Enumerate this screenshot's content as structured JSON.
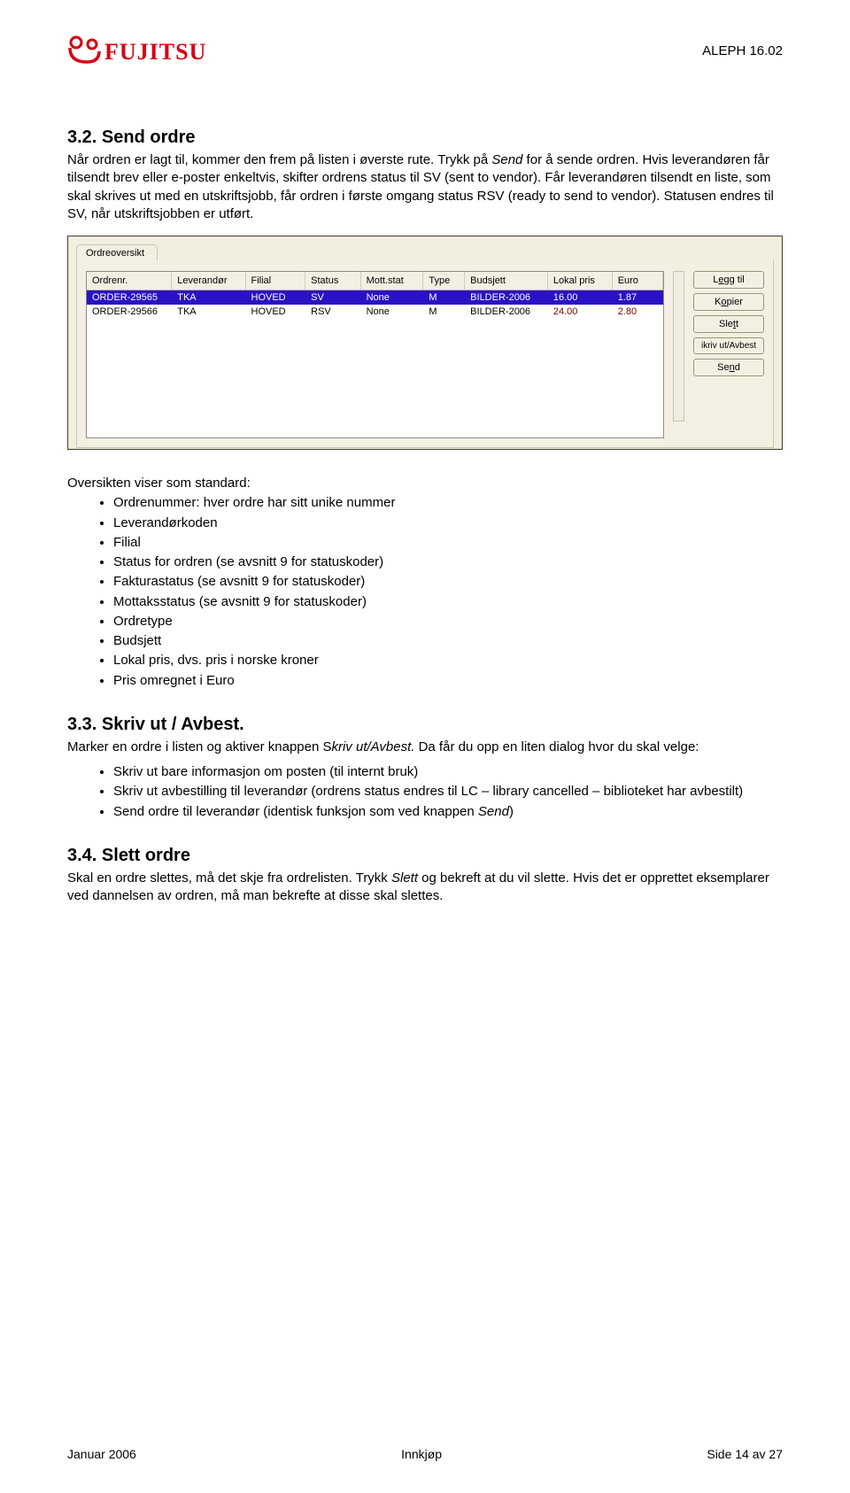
{
  "header": {
    "logo_text": "FUJITSU",
    "right": "ALEPH 16.02"
  },
  "sections": {
    "s32": {
      "title": "3.2.   Send ordre",
      "p1a": "Når ordren er lagt til, kommer den frem på listen i øverste rute. Trykk på ",
      "p1b_i": "Send",
      "p1c": " for å sende ordren. Hvis leverandøren får tilsendt brev eller e-poster enkeltvis, skifter ordrens status til SV (sent to vendor). Får leverandøren tilsendt en liste, som skal skrives ut med en utskriftsjobb, får ordren i første omgang status RSV (ready to send to vendor). Statusen endres til SV, når utskriftsjobben er utført."
    },
    "overview": {
      "intro": "Oversikten viser som standard:",
      "items": [
        "Ordrenummer: hver ordre har sitt unike nummer",
        "Leverandørkoden",
        "Filial",
        "Status for ordren (se avsnitt 9 for statuskoder)",
        "Fakturastatus (se avsnitt 9 for statuskoder)",
        "Mottaksstatus (se avsnitt 9 for statuskoder)",
        "Ordretype",
        "Budsjett",
        "Lokal pris, dvs. pris i norske kroner",
        "Pris omregnet i Euro"
      ]
    },
    "s33": {
      "title": "3.3.   Skriv ut / Avbest.",
      "p1a": "Marker en ordre i listen og aktiver knappen S",
      "p1b_i": "kriv ut/Avbest.",
      "p1c": " Da får du opp en liten dialog hvor du skal velge:",
      "items": [
        "Skriv ut bare informasjon om posten (til internt bruk)",
        "Skriv ut avbestilling til leverandør (ordrens status endres til LC – library cancelled – biblioteket har avbestilt)"
      ],
      "item3a": "Send ordre til leverandør (identisk funksjon som ved knappen ",
      "item3b_i": "Send",
      "item3c": ")"
    },
    "s34": {
      "title": "3.4.   Slett ordre",
      "p1a": "Skal en ordre slettes, må det skje fra ordrelisten. Trykk ",
      "p1b_i": "Slett",
      "p1c": " og bekreft at du vil slette. Hvis det er opprettet eksemplarer ved dannelsen av ordren, må man bekrefte at disse skal slettes."
    }
  },
  "app": {
    "tab": "Ordreoversikt",
    "headers": [
      "Ordrenr.",
      "Leverandør",
      "Filial",
      "Status",
      "Mott.stat",
      "Type",
      "Budsjett",
      "Lokal pris",
      "Euro"
    ],
    "rows": [
      {
        "cells": [
          "ORDER-29565",
          "TKA",
          "HOVED",
          "SV",
          "None",
          "M",
          "BILDER-2006",
          "16.00",
          "1.87"
        ],
        "selected": true
      },
      {
        "cells": [
          "ORDER-29566",
          "TKA",
          "HOVED",
          "RSV",
          "None",
          "M",
          "BILDER-2006",
          "24.00",
          "2.80"
        ],
        "selected": false
      }
    ],
    "buttons": {
      "add_pre": "L",
      "add_u": "e",
      "add_post": "gg til",
      "copy_pre": "K",
      "copy_u": "o",
      "copy_post": "pier",
      "del_pre": "Sle",
      "del_u": "t",
      "del_post": "t",
      "print": "ikriv ut/Avbest",
      "send_pre": "Se",
      "send_u": "n",
      "send_post": "d"
    }
  },
  "footer": {
    "left": "Januar 2006",
    "center": "Innkjøp",
    "right": "Side 14 av 27"
  }
}
